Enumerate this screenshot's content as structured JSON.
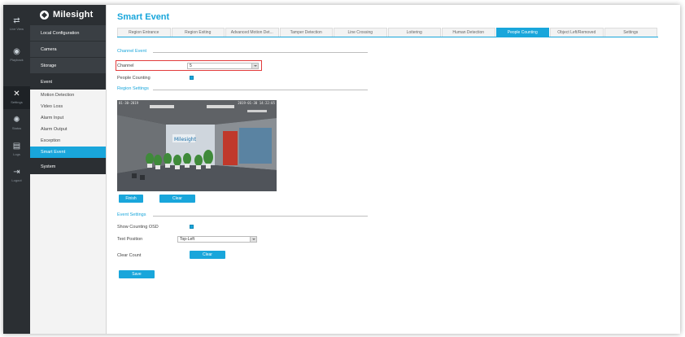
{
  "brand": {
    "name": "Milesight"
  },
  "rail": [
    {
      "label": "Live View",
      "icon": "live-view-icon",
      "glyph": "⇄"
    },
    {
      "label": "Playback",
      "icon": "playback-icon",
      "glyph": "◉"
    },
    {
      "label": "Settings",
      "icon": "settings-icon",
      "glyph": "✕"
    },
    {
      "label": "Status",
      "icon": "status-icon",
      "glyph": "✺"
    },
    {
      "label": "Logs",
      "icon": "logs-icon",
      "glyph": "▤"
    },
    {
      "label": "Logout",
      "icon": "logout-icon",
      "glyph": "⇥"
    }
  ],
  "menu": {
    "local_configuration": "Local Configuration",
    "camera": "Camera",
    "storage": "Storage",
    "event": "Event",
    "event_items": [
      "Motion Detection",
      "Video Loss",
      "Alarm Input",
      "Alarm Output",
      "Exception",
      "Smart Event"
    ],
    "system": "System"
  },
  "page": {
    "title": "Smart Event"
  },
  "tabs": [
    "Region Entrance",
    "Region Exiting",
    "Advanced Motion Det...",
    "Tamper Detection",
    "Line Crossing",
    "Loitering",
    "Human Detection",
    "People Counting",
    "Object Left/Removed",
    "Settings"
  ],
  "active_tab": "People Counting",
  "channel_event": {
    "section_title": "Channel Event",
    "channel_label": "Channel",
    "channel_value": "5",
    "people_counting_label": "People Counting",
    "people_counting_enabled": true
  },
  "region_settings": {
    "section_title": "Region Settings",
    "overlay_left": "01-30-2019",
    "overlay_right": "2019-01-30 14:22:05",
    "finish_label": "Finish",
    "clear_label": "Clear"
  },
  "event_settings": {
    "section_title": "Event Settings",
    "osd_label": "Show Counting OSD",
    "osd_enabled": true,
    "text_position_label": "Text Position",
    "text_position_value": "Top-Left",
    "clear_count_label": "Clear Count",
    "clear_count_button": "Clear",
    "save_label": "Save"
  },
  "colors": {
    "accent": "#19a6db",
    "sidebar_dark": "#2b2f33",
    "highlight": "#e23c3c"
  }
}
